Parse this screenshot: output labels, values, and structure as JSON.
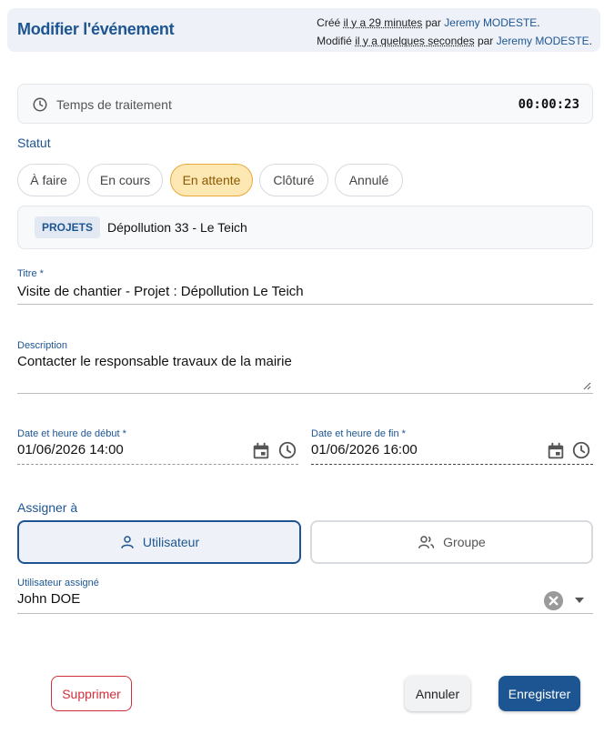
{
  "header": {
    "title": "Modifier l'événement",
    "created_prefix": "Créé",
    "created_rel": "il y a 29 minutes",
    "created_by_prefix": "par",
    "created_user": "Jeremy MODESTE",
    "modified_prefix": "Modifié",
    "modified_rel": "il y a quelques secondes",
    "modified_by_prefix": "par",
    "modified_user": "Jeremy MODESTE",
    "period": "."
  },
  "timer": {
    "label": "Temps de traitement",
    "value": "00:00:23"
  },
  "status": {
    "label": "Statut",
    "options": [
      "À faire",
      "En cours",
      "En attente",
      "Clôturé",
      "Annulé"
    ],
    "selected": "En attente"
  },
  "project": {
    "badge": "PROJETS",
    "name": "Dépollution 33 - Le Teich"
  },
  "title_field": {
    "label": "Titre *",
    "value": "Visite de chantier - Projet : Dépollution Le Teich"
  },
  "description_field": {
    "label": "Description",
    "value": "Contacter le responsable travaux de la mairie"
  },
  "start_field": {
    "label": "Date et heure de début *",
    "value": "01/06/2026 14:00"
  },
  "end_field": {
    "label": "Date et heure de fin *",
    "value": "01/06/2026 16:00"
  },
  "assign": {
    "label": "Assigner à",
    "user_option": "Utilisateur",
    "group_option": "Groupe",
    "selected": "Utilisateur"
  },
  "assigned_user": {
    "label": "Utilisateur assigné",
    "value": "John DOE"
  },
  "actions": {
    "delete": "Supprimer",
    "cancel": "Annuler",
    "save": "Enregistrer"
  },
  "colors": {
    "primary": "#1d5592",
    "pending_bg": "#fde7b3",
    "pending_border": "#e8a83a",
    "danger": "#d32f3a"
  }
}
